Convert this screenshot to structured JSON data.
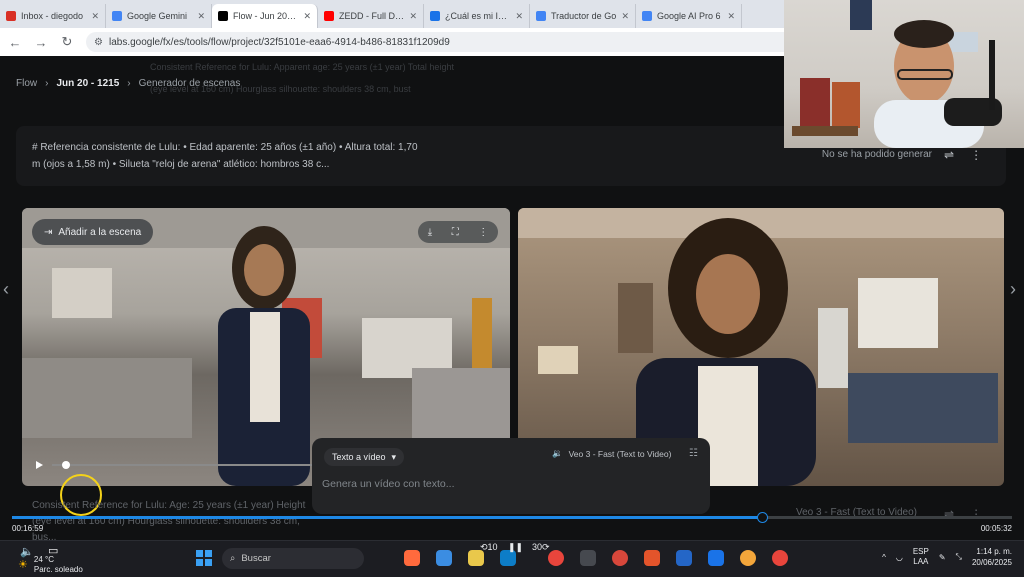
{
  "browser": {
    "tabs": [
      {
        "title": "Inbox - diegodo",
        "color": "#d93025",
        "active": false
      },
      {
        "title": "Google Gemini",
        "color": "#4285f4",
        "active": false
      },
      {
        "title": "Flow - Jun 20 - 1",
        "color": "#000000",
        "active": true
      },
      {
        "title": "ZEDD - Full DJ S",
        "color": "#ff0000",
        "active": false
      },
      {
        "title": "¿Cuál es mi IP? U",
        "color": "#1a73e8",
        "active": false
      },
      {
        "title": "Traductor de Go",
        "color": "#4285f4",
        "active": false
      },
      {
        "title": "Google AI Pro 6",
        "color": "#4285f4",
        "active": false
      }
    ],
    "url": "labs.google/fx/es/tools/flow/project/32f5101e-eaa6-4914-b486-81831f1209d9"
  },
  "breadcrumb": {
    "root": "Flow",
    "project": "Jun 20 - 1215",
    "section": "Generador de escenas"
  },
  "ghost_text": {
    "line1": "Consistent Reference for Lulu: Apparent age: 25 years (±1 year) Total height",
    "line2": "(eye level at 160 cm) Hourglass silhouette: shoulders 38 cm, bust"
  },
  "prompt_card": {
    "text": "# Referencia consistente de Lulu: • Edad aparente: 25 años (±1 año) • Altura total: 1,70 m (ojos a 1,58 m) • Silueta \"reloj de arena\" atlético: hombros 38 c...",
    "status": "No se ha podido generar"
  },
  "clip_actions": {
    "add_to_scene": "Añadir a la escena"
  },
  "composer": {
    "mode": "Texto a vídeo",
    "model": "Veo 3 - Fast (Text to Video)",
    "placeholder": "Genera un vídeo con texto..."
  },
  "second_prompt": {
    "text": "Consistent Reference for Lulu: Age: 25 years (±1 year) Height (eye level at 160 cm) Hourglass silhouette: shoulders 38 cm, bus...",
    "model": "Veo 3 - Fast (Text to Video)"
  },
  "player": {
    "elapsed": "00:16:59",
    "remaining": "00:05:32",
    "progress": 0.75
  },
  "taskbar": {
    "weather_temp": "24 °C",
    "weather_desc": "Parc. soleado",
    "search": "Buscar",
    "lang": "ESP",
    "lang_sub": "LAA",
    "time": "1:14 p. m.",
    "date": "20/06/2025"
  },
  "colors": {
    "accent": "#1e88e5",
    "cursor_ring": "#f4d21a"
  }
}
